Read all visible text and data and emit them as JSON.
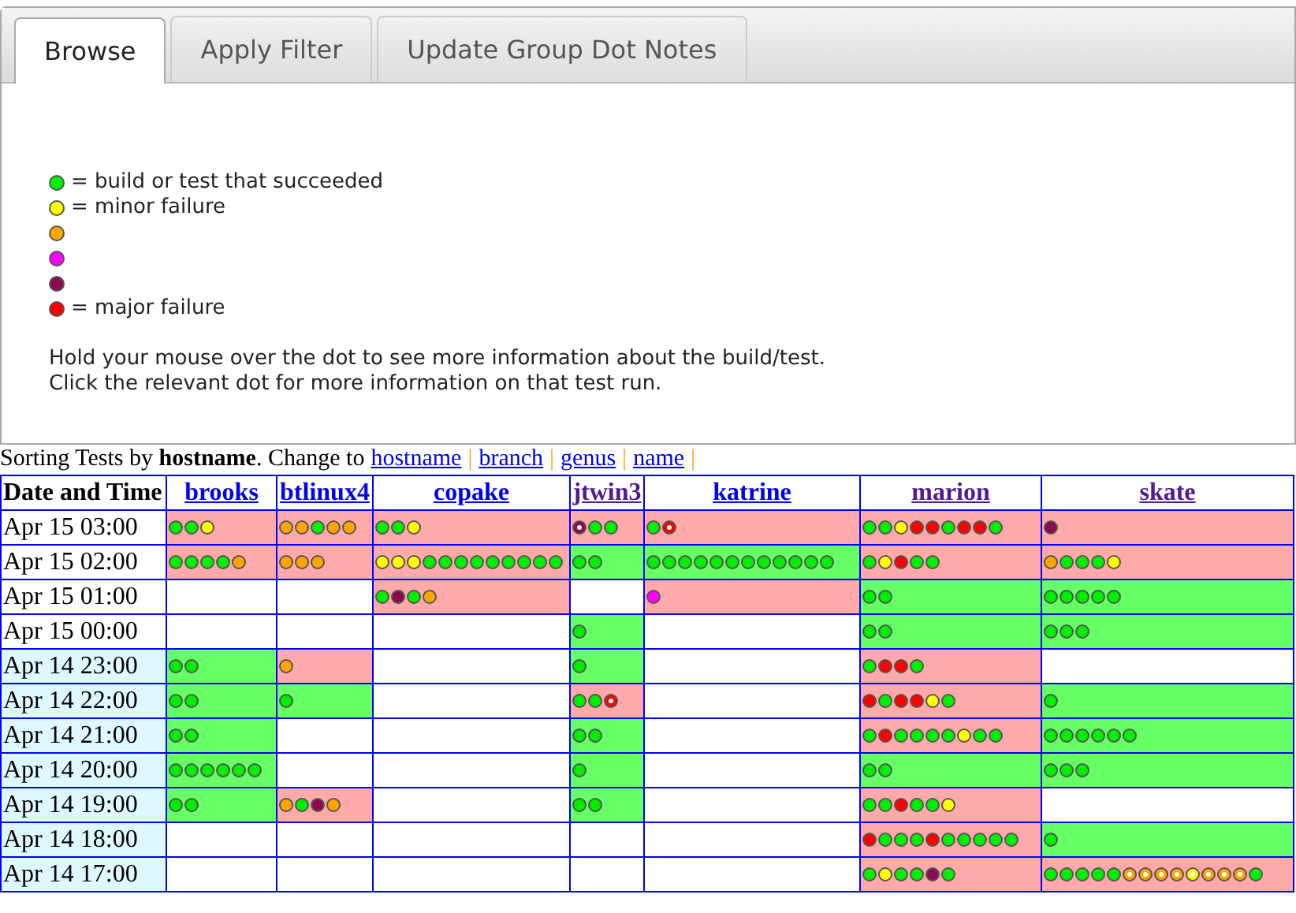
{
  "tabs": [
    {
      "label": "Browse",
      "selected": true
    },
    {
      "label": "Apply Filter",
      "selected": false
    },
    {
      "label": "Update Group Dot Notes",
      "selected": false
    }
  ],
  "legend": [
    {
      "color": "#00ee00",
      "label": "= build or test that succeeded"
    },
    {
      "color": "#ffff00",
      "label": "= minor failure"
    },
    {
      "color": "#ffa500"
    },
    {
      "color": "#ff00ff"
    },
    {
      "color": "#8b0a50"
    },
    {
      "color": "#ff0000",
      "label": "= major failure"
    }
  ],
  "help": [
    "Hold your mouse over the dot to see more information about the build/test.",
    "Click the relevant dot for more information on that test run."
  ],
  "sorting": {
    "text": "Sorting Tests by **hostname**. Change to",
    "links": [
      {
        "label": "hostname",
        "separator": "|"
      },
      {
        "label": "branch",
        "separator": "|"
      },
      {
        "label": "genus",
        "separator": "|"
      },
      {
        "label": "name",
        "separator": "|"
      }
    ]
  },
  "table": {
    "date_header": "Date and Time",
    "hosts": [
      {
        "name": "brooks",
        "visited": false
      },
      {
        "name": "btlinux4",
        "visited": false
      },
      {
        "name": "copake",
        "visited": false
      },
      {
        "name": "jtwin3",
        "visited": true
      },
      {
        "name": "katrine",
        "visited": false
      },
      {
        "name": "marion",
        "visited": true
      },
      {
        "name": "skate",
        "visited": true
      }
    ],
    "rows": [
      {
        "time": "Apr 15 03:00",
        "shaded": false,
        "cells": [
          {
            "kind": "fail",
            "dots": [
              {
                "kind": "success"
              },
              {
                "kind": "success"
              },
              {
                "kind": "minor"
              }
            ]
          },
          {
            "kind": "fail",
            "dots": [
              {
                "kind": "orange"
              },
              {
                "kind": "orange"
              },
              {
                "kind": "success"
              },
              {
                "kind": "orange"
              },
              {
                "kind": "orange"
              }
            ]
          },
          {
            "kind": "fail",
            "dots": [
              {
                "kind": "success"
              },
              {
                "kind": "success"
              },
              {
                "kind": "minor"
              }
            ]
          },
          {
            "kind": "fail",
            "dots": [
              {
                "kind": "purple-noted"
              },
              {
                "kind": "success"
              },
              {
                "kind": "success"
              }
            ]
          },
          {
            "kind": "fail",
            "dots": [
              {
                "kind": "success"
              },
              {
                "kind": "major-noted"
              }
            ]
          },
          {
            "kind": "fail",
            "dots": [
              {
                "kind": "success"
              },
              {
                "kind": "success"
              },
              {
                "kind": "minor"
              },
              {
                "kind": "major"
              },
              {
                "kind": "major"
              },
              {
                "kind": "success"
              },
              {
                "kind": "major"
              },
              {
                "kind": "major"
              },
              {
                "kind": "success"
              }
            ]
          },
          {
            "kind": "fail",
            "dots": [
              {
                "kind": "purple"
              }
            ]
          }
        ]
      },
      {
        "time": "Apr 15 02:00",
        "shaded": false,
        "cells": [
          {
            "kind": "fail",
            "dots": [
              {
                "kind": "success"
              },
              {
                "kind": "success"
              },
              {
                "kind": "success"
              },
              {
                "kind": "success"
              },
              {
                "kind": "orange"
              }
            ]
          },
          {
            "kind": "fail",
            "dots": [
              {
                "kind": "orange"
              },
              {
                "kind": "orange"
              },
              {
                "kind": "orange"
              }
            ]
          },
          {
            "kind": "fail",
            "dots": [
              {
                "kind": "minor"
              },
              {
                "kind": "minor"
              },
              {
                "kind": "minor"
              },
              {
                "kind": "success"
              },
              {
                "kind": "success"
              },
              {
                "kind": "success"
              },
              {
                "kind": "success"
              },
              {
                "kind": "success"
              },
              {
                "kind": "success"
              },
              {
                "kind": "success"
              },
              {
                "kind": "success"
              },
              {
                "kind": "success"
              }
            ]
          },
          {
            "kind": "pass",
            "dots": [
              {
                "kind": "success"
              },
              {
                "kind": "success"
              }
            ]
          },
          {
            "kind": "pass",
            "dots": [
              {
                "kind": "success"
              },
              {
                "kind": "success"
              },
              {
                "kind": "success"
              },
              {
                "kind": "success"
              },
              {
                "kind": "success"
              },
              {
                "kind": "success"
              },
              {
                "kind": "success"
              },
              {
                "kind": "success"
              },
              {
                "kind": "success"
              },
              {
                "kind": "success"
              },
              {
                "kind": "success"
              },
              {
                "kind": "success"
              }
            ]
          },
          {
            "kind": "fail",
            "dots": [
              {
                "kind": "success"
              },
              {
                "kind": "minor"
              },
              {
                "kind": "major"
              },
              {
                "kind": "success"
              },
              {
                "kind": "success"
              }
            ]
          },
          {
            "kind": "fail",
            "dots": [
              {
                "kind": "orange"
              },
              {
                "kind": "success"
              },
              {
                "kind": "success"
              },
              {
                "kind": "success"
              },
              {
                "kind": "minor"
              }
            ]
          }
        ]
      },
      {
        "time": "Apr 15 01:00",
        "shaded": false,
        "cells": [
          null,
          null,
          {
            "kind": "fail",
            "dots": [
              {
                "kind": "success"
              },
              {
                "kind": "purple"
              },
              {
                "kind": "success"
              },
              {
                "kind": "orange"
              }
            ]
          },
          null,
          {
            "kind": "fail",
            "dots": [
              {
                "kind": "magenta"
              }
            ]
          },
          {
            "kind": "pass",
            "dots": [
              {
                "kind": "success"
              },
              {
                "kind": "success"
              }
            ]
          },
          {
            "kind": "pass",
            "dots": [
              {
                "kind": "success"
              },
              {
                "kind": "success"
              },
              {
                "kind": "success"
              },
              {
                "kind": "success"
              },
              {
                "kind": "success"
              }
            ]
          }
        ]
      },
      {
        "time": "Apr 15 00:00",
        "shaded": false,
        "cells": [
          null,
          null,
          null,
          {
            "kind": "pass",
            "dots": [
              {
                "kind": "success"
              }
            ]
          },
          null,
          {
            "kind": "pass",
            "dots": [
              {
                "kind": "success"
              },
              {
                "kind": "success"
              }
            ]
          },
          {
            "kind": "pass",
            "dots": [
              {
                "kind": "success"
              },
              {
                "kind": "success"
              },
              {
                "kind": "success"
              }
            ]
          }
        ]
      },
      {
        "time": "Apr 14 23:00",
        "shaded": true,
        "cells": [
          {
            "kind": "pass",
            "dots": [
              {
                "kind": "success"
              },
              {
                "kind": "success"
              }
            ]
          },
          {
            "kind": "fail",
            "dots": [
              {
                "kind": "orange"
              }
            ]
          },
          null,
          {
            "kind": "pass",
            "dots": [
              {
                "kind": "success"
              }
            ]
          },
          null,
          {
            "kind": "fail",
            "dots": [
              {
                "kind": "success"
              },
              {
                "kind": "major"
              },
              {
                "kind": "major"
              },
              {
                "kind": "success"
              }
            ]
          },
          null
        ]
      },
      {
        "time": "Apr 14 22:00",
        "shaded": true,
        "cells": [
          {
            "kind": "pass",
            "dots": [
              {
                "kind": "success"
              },
              {
                "kind": "success"
              }
            ]
          },
          {
            "kind": "pass",
            "dots": [
              {
                "kind": "success"
              }
            ]
          },
          null,
          {
            "kind": "fail",
            "dots": [
              {
                "kind": "success"
              },
              {
                "kind": "success"
              },
              {
                "kind": "major-noted"
              }
            ]
          },
          null,
          {
            "kind": "fail",
            "dots": [
              {
                "kind": "major"
              },
              {
                "kind": "success"
              },
              {
                "kind": "major"
              },
              {
                "kind": "major"
              },
              {
                "kind": "minor"
              },
              {
                "kind": "success"
              }
            ]
          },
          {
            "kind": "pass",
            "dots": [
              {
                "kind": "success"
              }
            ]
          }
        ]
      },
      {
        "time": "Apr 14 21:00",
        "shaded": true,
        "cells": [
          {
            "kind": "pass",
            "dots": [
              {
                "kind": "success"
              },
              {
                "kind": "success"
              }
            ]
          },
          null,
          null,
          {
            "kind": "pass",
            "dots": [
              {
                "kind": "success"
              },
              {
                "kind": "success"
              }
            ]
          },
          null,
          {
            "kind": "fail",
            "dots": [
              {
                "kind": "success"
              },
              {
                "kind": "major"
              },
              {
                "kind": "success"
              },
              {
                "kind": "success"
              },
              {
                "kind": "success"
              },
              {
                "kind": "success"
              },
              {
                "kind": "minor"
              },
              {
                "kind": "success"
              },
              {
                "kind": "success"
              }
            ]
          },
          {
            "kind": "pass",
            "dots": [
              {
                "kind": "success"
              },
              {
                "kind": "success"
              },
              {
                "kind": "success"
              },
              {
                "kind": "success"
              },
              {
                "kind": "success"
              },
              {
                "kind": "success"
              }
            ]
          }
        ]
      },
      {
        "time": "Apr 14 20:00",
        "shaded": true,
        "cells": [
          {
            "kind": "pass",
            "dots": [
              {
                "kind": "success"
              },
              {
                "kind": "success"
              },
              {
                "kind": "success"
              },
              {
                "kind": "success"
              },
              {
                "kind": "success"
              },
              {
                "kind": "success"
              }
            ]
          },
          null,
          null,
          {
            "kind": "pass",
            "dots": [
              {
                "kind": "success"
              }
            ]
          },
          null,
          {
            "kind": "pass",
            "dots": [
              {
                "kind": "success"
              },
              {
                "kind": "success"
              }
            ]
          },
          {
            "kind": "pass",
            "dots": [
              {
                "kind": "success"
              },
              {
                "kind": "success"
              },
              {
                "kind": "success"
              }
            ]
          }
        ]
      },
      {
        "time": "Apr 14 19:00",
        "shaded": true,
        "cells": [
          {
            "kind": "pass",
            "dots": [
              {
                "kind": "success"
              },
              {
                "kind": "success"
              }
            ]
          },
          {
            "kind": "fail",
            "dots": [
              {
                "kind": "orange"
              },
              {
                "kind": "success"
              },
              {
                "kind": "purple"
              },
              {
                "kind": "orange"
              }
            ]
          },
          null,
          {
            "kind": "pass",
            "dots": [
              {
                "kind": "success"
              },
              {
                "kind": "success"
              }
            ]
          },
          null,
          {
            "kind": "fail",
            "dots": [
              {
                "kind": "success"
              },
              {
                "kind": "success"
              },
              {
                "kind": "major"
              },
              {
                "kind": "success"
              },
              {
                "kind": "success"
              },
              {
                "kind": "minor"
              }
            ]
          },
          null
        ]
      },
      {
        "time": "Apr 14 18:00",
        "shaded": true,
        "cells": [
          null,
          null,
          null,
          null,
          null,
          {
            "kind": "fail",
            "dots": [
              {
                "kind": "major"
              },
              {
                "kind": "success"
              },
              {
                "kind": "success"
              },
              {
                "kind": "success"
              },
              {
                "kind": "major"
              },
              {
                "kind": "success"
              },
              {
                "kind": "success"
              },
              {
                "kind": "success"
              },
              {
                "kind": "success"
              },
              {
                "kind": "success"
              }
            ]
          },
          {
            "kind": "pass",
            "dots": [
              {
                "kind": "success"
              }
            ]
          }
        ]
      },
      {
        "time": "Apr 14 17:00",
        "shaded": true,
        "cells": [
          null,
          null,
          null,
          null,
          null,
          {
            "kind": "fail",
            "dots": [
              {
                "kind": "success"
              },
              {
                "kind": "minor"
              },
              {
                "kind": "success"
              },
              {
                "kind": "success"
              },
              {
                "kind": "purple"
              },
              {
                "kind": "success"
              }
            ]
          },
          {
            "kind": "fail",
            "dots": [
              {
                "kind": "success"
              },
              {
                "kind": "success"
              },
              {
                "kind": "success"
              },
              {
                "kind": "success"
              },
              {
                "kind": "success"
              },
              {
                "kind": "orange-noted"
              },
              {
                "kind": "orange-noted"
              },
              {
                "kind": "orange-noted"
              },
              {
                "kind": "orange-noted"
              },
              {
                "kind": "minor-noted"
              },
              {
                "kind": "orange-noted"
              },
              {
                "kind": "orange-noted"
              },
              {
                "kind": "orange-noted"
              },
              {
                "kind": "success"
              }
            ]
          }
        ]
      }
    ]
  }
}
